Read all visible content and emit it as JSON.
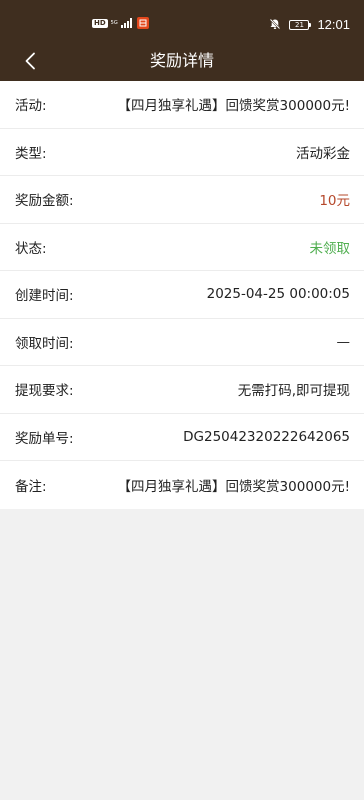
{
  "status_bar": {
    "hd_label": "HD",
    "network_label": "5G",
    "signal_icon": "signal-icon",
    "app_notification_icon": "app-badge-icon",
    "mute_icon": "bell-off-icon",
    "battery_level": "21",
    "time": "12:01"
  },
  "nav": {
    "back_icon": "chevron-left-icon",
    "title": "奖励详情"
  },
  "details": {
    "activity": {
      "label": "活动:",
      "value": "【四月独享礼遇】回馈奖赏300000元!"
    },
    "type": {
      "label": "类型:",
      "value": "活动彩金"
    },
    "amount": {
      "label": "奖励金额:",
      "value": "10元"
    },
    "status": {
      "label": "状态:",
      "value": "未领取"
    },
    "created_time": {
      "label": "创建时间:",
      "value": "2025-04-25 00:00:05"
    },
    "claim_time": {
      "label": "领取时间:",
      "value": "—"
    },
    "withdraw_req": {
      "label": "提现要求:",
      "value": "无需打码,即可提现"
    },
    "order_no": {
      "label": "奖励单号:",
      "value": "DG25042320222642065"
    },
    "remark": {
      "label": "备注:",
      "value": "【四月独享礼遇】回馈奖赏300000元!"
    }
  },
  "colors": {
    "header_bg": "#3f2e1f",
    "amount": "#b5482b",
    "status_unclaimed": "#4fae4f",
    "page_bg": "#f1f1f1"
  }
}
